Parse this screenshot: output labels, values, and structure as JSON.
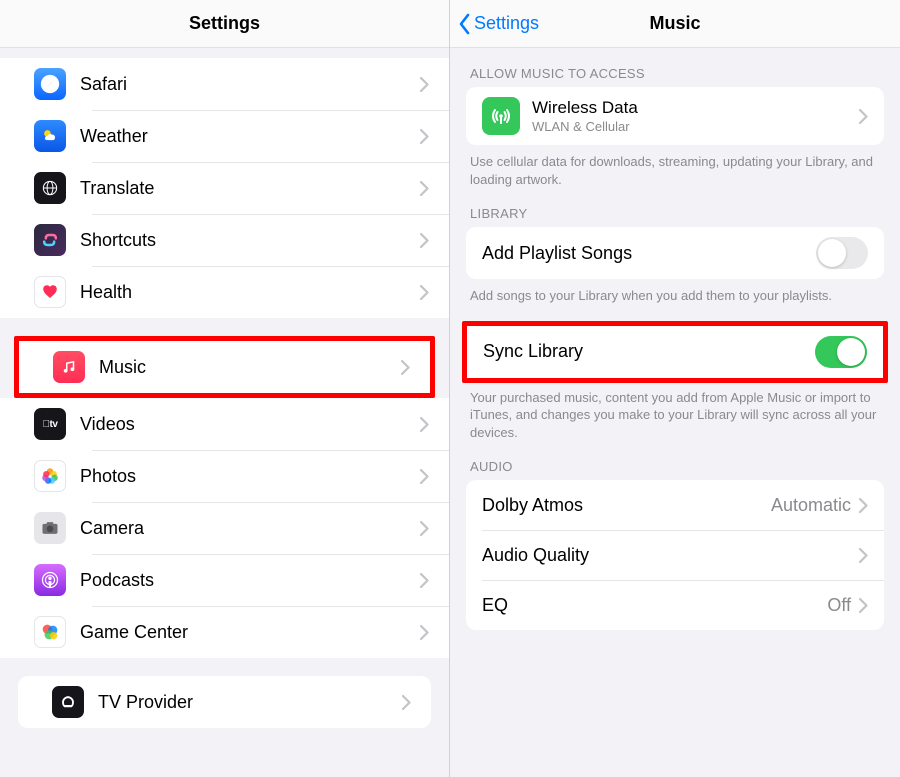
{
  "left": {
    "title": "Settings",
    "group1": [
      {
        "label": "Safari"
      },
      {
        "label": "Weather"
      },
      {
        "label": "Translate"
      },
      {
        "label": "Shortcuts"
      },
      {
        "label": "Health"
      }
    ],
    "group2": [
      {
        "label": "Music"
      },
      {
        "label": "Videos"
      },
      {
        "label": "Photos"
      },
      {
        "label": "Camera"
      },
      {
        "label": "Podcasts"
      },
      {
        "label": "Game Center"
      }
    ],
    "group3": [
      {
        "label": "TV Provider"
      }
    ]
  },
  "right": {
    "back": "Settings",
    "title": "Music",
    "allow_header": "ALLOW MUSIC TO ACCESS",
    "wireless": {
      "title": "Wireless Data",
      "subtitle": "WLAN & Cellular"
    },
    "wireless_footer": "Use cellular data for downloads, streaming, updating your Library, and loading artwork.",
    "library_header": "LIBRARY",
    "add_playlist": {
      "title": "Add Playlist Songs"
    },
    "add_playlist_footer": "Add songs to your Library when you add them to your playlists.",
    "sync_library": {
      "title": "Sync Library"
    },
    "sync_library_footer": "Your purchased music, content you add from Apple Music or import to iTunes, and changes you make to your Library will sync across all your devices.",
    "audio_header": "AUDIO",
    "dolby": {
      "title": "Dolby Atmos",
      "value": "Automatic"
    },
    "audio_quality": {
      "title": "Audio Quality"
    },
    "eq": {
      "title": "EQ",
      "value": "Off"
    }
  }
}
